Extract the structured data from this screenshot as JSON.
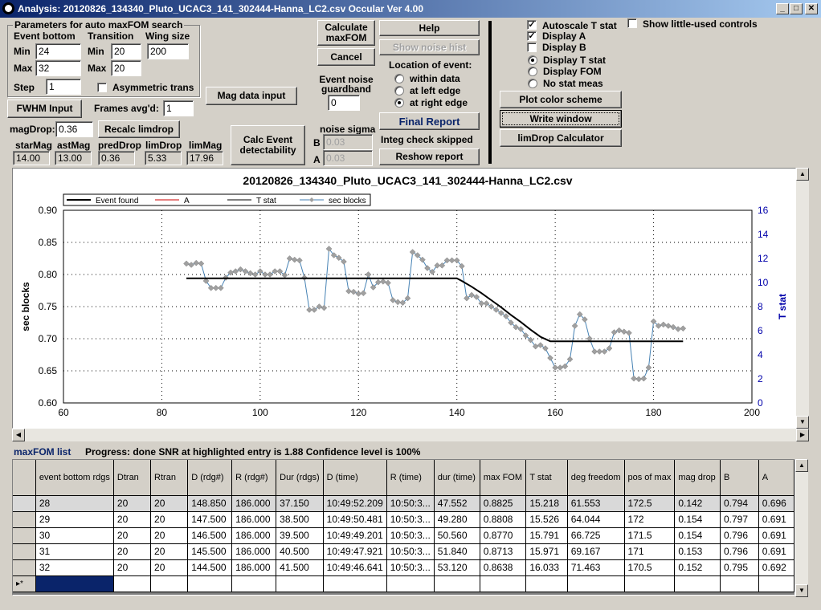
{
  "window": {
    "title": "Analysis: 20120826_134340_Pluto_UCAC3_141_302444-Hanna_LC2.csv  Occular Ver 4.00",
    "min_glyph": "_",
    "max_glyph": "□",
    "close_glyph": "✕"
  },
  "params": {
    "group_title": "Parameters for auto maxFOM search",
    "event_bottom_label": "Event bottom",
    "transition_label": "Transition",
    "wing_size_label": "Wing size",
    "min_label": "Min",
    "max_label": "Max",
    "min_label2": "Min",
    "max_label2": "Max",
    "step_label": "Step",
    "event_bottom_min": "24",
    "event_bottom_max": "32",
    "transition_min": "20",
    "transition_max": "20",
    "wing_size": "200",
    "step": "1",
    "asymmetric_label": "Asymmetric trans"
  },
  "controls": {
    "fwhm_input": "FWHM Input",
    "frames_avgd_label": "Frames avg'd:",
    "frames_avgd": "1",
    "mag_data_input": "Mag data input",
    "magdrop_label": "magDrop:",
    "magdrop": "0.36",
    "recalc_limdrop": "Recalc limdrop",
    "calc_event_det": "Calc Event detectability",
    "calculate_maxfom": "Calculate maxFOM",
    "cancel": "Cancel",
    "event_noise_label": "Event noise guardband",
    "event_noise": "0",
    "noise_sigma_label": "noise sigma",
    "b_label": "B",
    "a_label": "A",
    "noise_b": "0.03",
    "noise_a": "0.03",
    "help": "Help",
    "show_noise_hist": "Show noise hist",
    "location_label": "Location of event:",
    "loc_within": "within data",
    "loc_left": "at left edge",
    "loc_right": "at right edge",
    "final_report": "Final Report",
    "integ_check": "Integ check skipped",
    "reshow_report": "Reshow report",
    "autoscale": "Autoscale T stat",
    "display_a": "Display A",
    "display_b": "Display B",
    "display_t": "Display T stat",
    "display_fom": "Display FOM",
    "no_stat": "No stat meas",
    "show_little": "Show little-used controls",
    "plot_color": "Plot color scheme",
    "write_window": "Write window",
    "limdrop_calc": "limDrop Calculator",
    "check_glyph": "✓"
  },
  "mags": {
    "star_label": "starMag",
    "star": "14.00",
    "ast_label": "astMag",
    "ast": "13.00",
    "pred_label": "predDrop",
    "pred": "0.36",
    "lim_label": "limDrop",
    "lim": "5.33",
    "limmag_label": "limMag",
    "limmag": "17.96"
  },
  "chart_data": {
    "type": "line",
    "title": "20120826_134340_Pluto_UCAC3_141_302444-Hanna_LC2.csv",
    "xlabel": "",
    "ylabel": "sec blocks",
    "y2label": "T stat",
    "xlim": [
      60,
      200
    ],
    "ylim": [
      0.6,
      0.9
    ],
    "y2lim": [
      0,
      16
    ],
    "xticks": [
      60,
      80,
      100,
      120,
      140,
      160,
      180,
      200
    ],
    "yticks": [
      0.6,
      0.65,
      0.7,
      0.75,
      0.8,
      0.85,
      0.9
    ],
    "y2ticks": [
      0,
      2,
      4,
      6,
      8,
      10,
      12,
      14,
      16
    ],
    "grid": true,
    "legend": "top-left",
    "legend_entries": [
      "Event found",
      "A",
      "T stat",
      "sec blocks"
    ],
    "series": [
      {
        "name": "sec blocks",
        "x": [
          85,
          86,
          87,
          88,
          89,
          90,
          91,
          92,
          93,
          94,
          95,
          96,
          97,
          98,
          99,
          100,
          101,
          102,
          103,
          104,
          105,
          106,
          107,
          108,
          109,
          110,
          111,
          112,
          113,
          114,
          115,
          116,
          117,
          118,
          119,
          120,
          121,
          122,
          123,
          124,
          125,
          126,
          127,
          128,
          129,
          130,
          131,
          132,
          133,
          134,
          135,
          136,
          137,
          138,
          139,
          140,
          141,
          142,
          143,
          144,
          145,
          146,
          147,
          148,
          149,
          150,
          151,
          152,
          153,
          154,
          155,
          156,
          157,
          158,
          159,
          160,
          161,
          162,
          163,
          164,
          165,
          166,
          167,
          168,
          169,
          170,
          171,
          172,
          173,
          174,
          175,
          176,
          177,
          178,
          179,
          180,
          181,
          182,
          183,
          184,
          185,
          186
        ],
        "y": [
          0.817,
          0.815,
          0.818,
          0.817,
          0.79,
          0.779,
          0.779,
          0.779,
          0.795,
          0.803,
          0.805,
          0.808,
          0.805,
          0.802,
          0.8,
          0.805,
          0.8,
          0.8,
          0.805,
          0.805,
          0.799,
          0.825,
          0.823,
          0.822,
          0.795,
          0.745,
          0.745,
          0.75,
          0.748,
          0.84,
          0.83,
          0.826,
          0.82,
          0.774,
          0.773,
          0.77,
          0.771,
          0.8,
          0.78,
          0.788,
          0.789,
          0.787,
          0.76,
          0.757,
          0.756,
          0.763,
          0.835,
          0.83,
          0.823,
          0.81,
          0.804,
          0.814,
          0.814,
          0.822,
          0.822,
          0.822,
          0.813,
          0.763,
          0.768,
          0.765,
          0.755,
          0.755,
          0.75,
          0.745,
          0.74,
          0.735,
          0.725,
          0.718,
          0.715,
          0.705,
          0.698,
          0.688,
          0.69,
          0.685,
          0.67,
          0.655,
          0.655,
          0.657,
          0.668,
          0.72,
          0.738,
          0.73,
          0.7,
          0.68,
          0.68,
          0.68,
          0.685,
          0.71,
          0.713,
          0.711,
          0.709,
          0.638,
          0.637,
          0.638,
          0.655,
          0.727,
          0.72,
          0.722,
          0.72,
          0.718,
          0.715,
          0.716
        ]
      },
      {
        "name": "Event found",
        "x": [
          85,
          140,
          141,
          143,
          145,
          147,
          149,
          151,
          153,
          155,
          157,
          159,
          186
        ],
        "y": [
          0.794,
          0.794,
          0.79,
          0.781,
          0.771,
          0.76,
          0.749,
          0.737,
          0.726,
          0.714,
          0.703,
          0.696,
          0.696
        ]
      }
    ]
  },
  "list": {
    "title": "maxFOM list",
    "progress": "Progress: done  SNR at highlighted entry is 1.88   Confidence level is  100%",
    "columns": [
      "event bottom rdgs",
      "Dtran",
      "Rtran",
      "D (rdg#)",
      "R (rdg#)",
      "Dur (rdgs)",
      "D (time)",
      "R (time)",
      "dur (time)",
      "max FOM",
      "T stat",
      "deg freedom",
      "pos of max",
      "mag drop",
      "B",
      "A"
    ],
    "rows": [
      [
        "28",
        "20",
        "20",
        "148.850",
        "186.000",
        "37.150",
        "10:49:52.209",
        "10:50:3...",
        "47.552",
        "0.8825",
        "15.218",
        "61.553",
        "172.5",
        "0.142",
        "0.794",
        "0.696"
      ],
      [
        "29",
        "20",
        "20",
        "147.500",
        "186.000",
        "38.500",
        "10:49:50.481",
        "10:50:3...",
        "49.280",
        "0.8808",
        "15.526",
        "64.044",
        "172",
        "0.154",
        "0.797",
        "0.691"
      ],
      [
        "30",
        "20",
        "20",
        "146.500",
        "186.000",
        "39.500",
        "10:49:49.201",
        "10:50:3...",
        "50.560",
        "0.8770",
        "15.791",
        "66.725",
        "171.5",
        "0.154",
        "0.796",
        "0.691"
      ],
      [
        "31",
        "20",
        "20",
        "145.500",
        "186.000",
        "40.500",
        "10:49:47.921",
        "10:50:3...",
        "51.840",
        "0.8713",
        "15.971",
        "69.167",
        "171",
        "0.153",
        "0.796",
        "0.691"
      ],
      [
        "32",
        "20",
        "20",
        "144.500",
        "186.000",
        "41.500",
        "10:49:46.641",
        "10:50:3...",
        "53.120",
        "0.8638",
        "16.033",
        "71.463",
        "170.5",
        "0.152",
        "0.795",
        "0.692"
      ]
    ],
    "new_row_marker": "▸*"
  },
  "colors": {
    "event": "#000000",
    "a": "#cc0000",
    "tstat": "#000000",
    "blocks": "#4682b4",
    "marker": "#a0a0a0",
    "axis2": "#0000aa"
  }
}
